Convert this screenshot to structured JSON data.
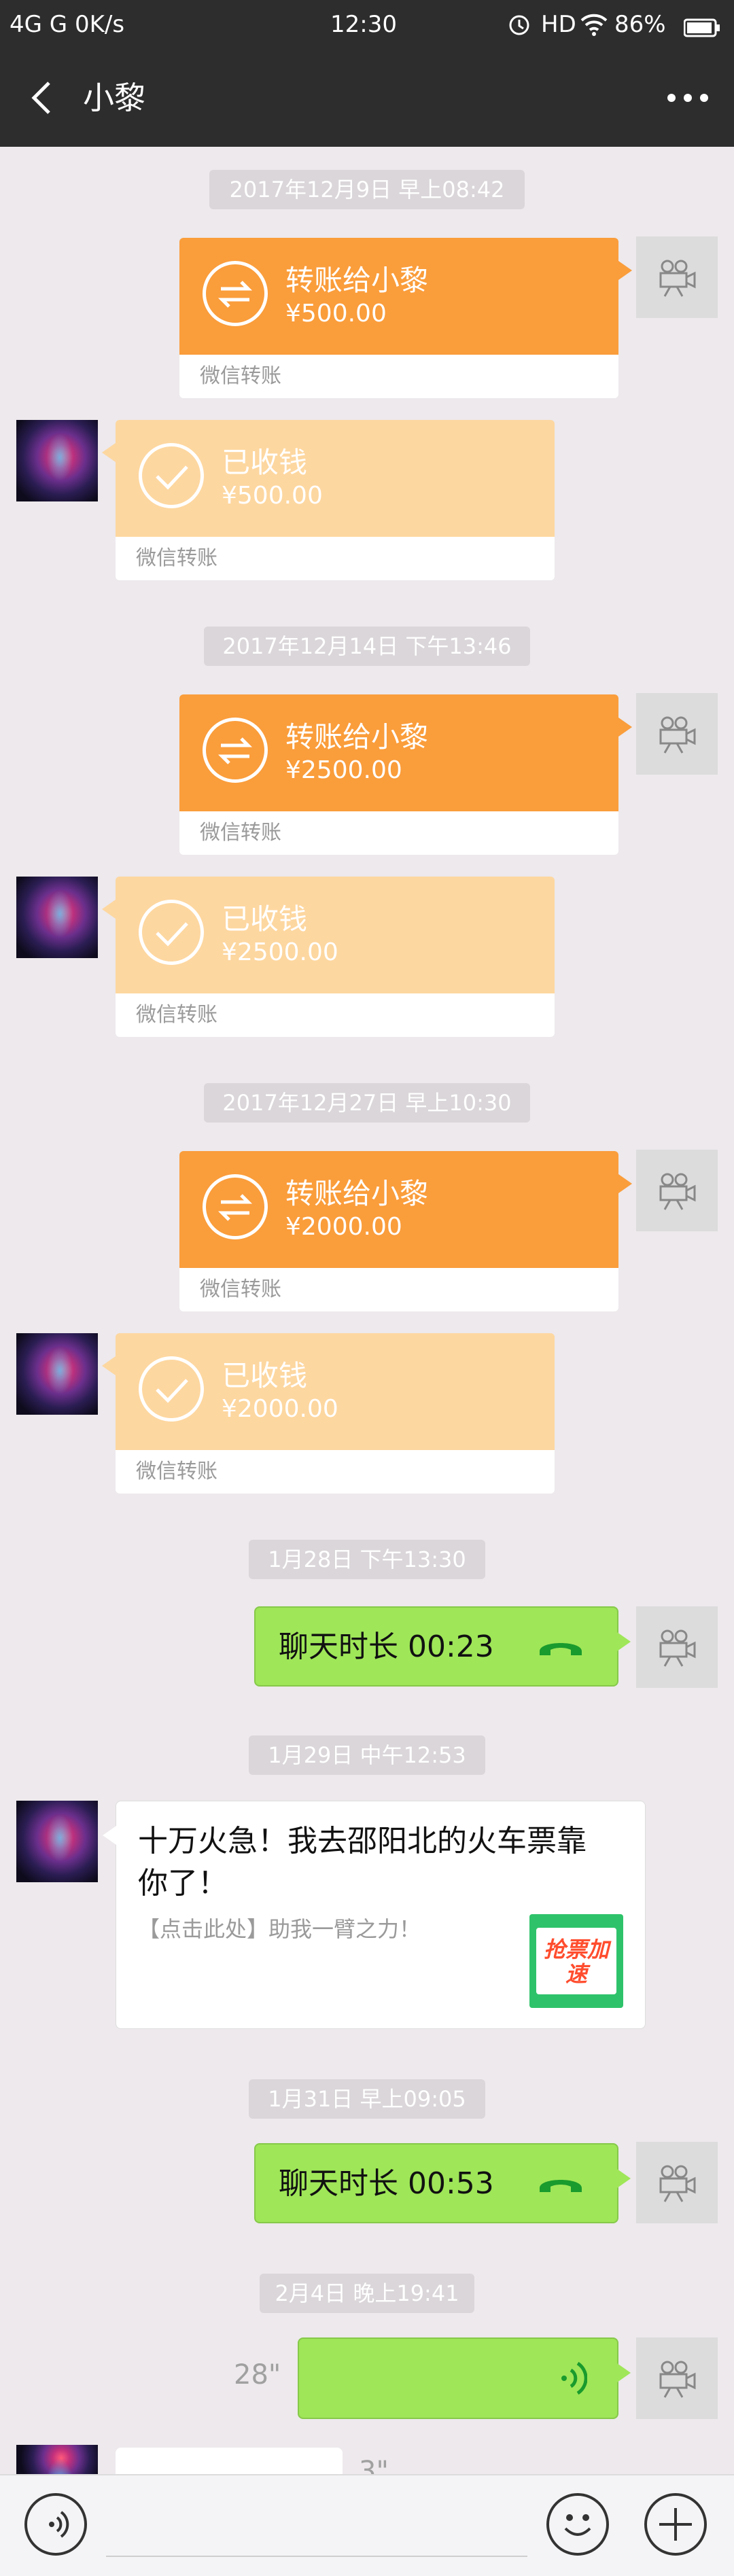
{
  "status_bar": {
    "left": "4G  G  0K/s",
    "time": "12:30",
    "hd": "HD",
    "battery": "86%"
  },
  "nav": {
    "title": "小黎"
  },
  "timestamps": [
    "2017年12月9日 早上08:42",
    "2017年12月14日 下午13:46",
    "2017年12月27日 早上10:30",
    "1月28日 下午13:30",
    "1月29日 中午12:53",
    "1月31日 早上09:05",
    "2月4日 晚上19:41"
  ],
  "transfers": [
    {
      "title": "转账给小黎",
      "amount": "¥500.00",
      "footer": "微信转账"
    },
    {
      "title": "已收钱",
      "amount": "¥500.00",
      "footer": "微信转账"
    },
    {
      "title": "转账给小黎",
      "amount": "¥2500.00",
      "footer": "微信转账"
    },
    {
      "title": "已收钱",
      "amount": "¥2500.00",
      "footer": "微信转账"
    },
    {
      "title": "转账给小黎",
      "amount": "¥2000.00",
      "footer": "微信转账"
    },
    {
      "title": "已收钱",
      "amount": "¥2000.00",
      "footer": "微信转账"
    }
  ],
  "calls": [
    {
      "label": "聊天时长 00:23"
    },
    {
      "label": "聊天时长 00:53"
    }
  ],
  "link": {
    "title": "十万火急！我去邵阳北的火车票靠你了！",
    "desc": "【点击此处】助我一臂之力！",
    "thumb_label": "抢票加速"
  },
  "voice": {
    "duration": "28\""
  },
  "partial": {
    "duration": "3\""
  },
  "colors": {
    "sent_transfer": "#fa9d3b",
    "received_transfer": "#fdd7a0",
    "call_bubble": "#9fe658",
    "nav_bg": "#2d2d2d"
  },
  "icons": [
    "back-arrow-icon",
    "more-icon",
    "transfer-arrows-icon",
    "check-icon",
    "phone-icon",
    "voice-waves-icon",
    "camera-icon",
    "smiley-icon",
    "plus-icon",
    "voice-input-icon"
  ]
}
